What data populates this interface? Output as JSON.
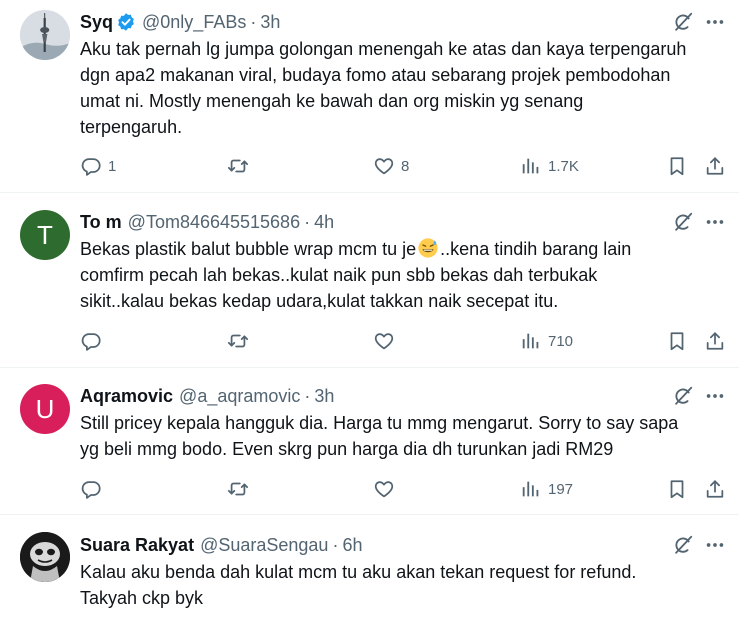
{
  "posts": [
    {
      "name": "Syq",
      "handle": "@0nly_FABs",
      "time": "3h",
      "verified": true,
      "lines": [
        "Aku tak pernah lg jumpa golongan menengah ke atas dan kaya terpengaruh",
        "dgn apa2 makanan viral, budaya fomo atau sebarang projek pembodohan",
        "umat ni. Mostly menengah ke bawah dan org miskin yg senang",
        "terpengaruh."
      ],
      "replies": "1",
      "reposts": "",
      "likes": "8",
      "views": "1.7K"
    },
    {
      "name": "To m",
      "handle": "@Tom846645515686",
      "time": "4h",
      "avatar_letter": "T",
      "avatar_color": "#2e6b2e",
      "lines_pre": "Bekas plastik balut bubble wrap mcm tu je",
      "lines_post": "..kena tindih barang lain",
      "lines": [
        "comfirm pecah lah bekas..kulat naik pun sbb bekas dah terbukak",
        "sikit..kalau bekas kedap udara,kulat takkan naik secepat itu."
      ],
      "replies": "",
      "reposts": "",
      "likes": "",
      "views": "710"
    },
    {
      "name": "Aqramovic",
      "handle": "@a_aqramovic",
      "time": "3h",
      "avatar_letter": "U",
      "avatar_color": "#d81e5b",
      "lines": [
        "Still pricey kepala hangguk dia. Harga tu mmg mengarut. Sorry to say sapa",
        "yg beli mmg bodo. Even skrg pun harga dia dh turunkan jadi RM29"
      ],
      "replies": "",
      "reposts": "",
      "likes": "",
      "views": "197"
    },
    {
      "name": "Suara Rakyat",
      "handle": "@SuaraSengau",
      "time": "6h",
      "lines": [
        "Kalau aku benda dah kulat mcm tu aku akan tekan request for refund.",
        "Takyah ckp byk"
      ]
    }
  ],
  "dot": "·",
  "colors": {
    "text": "#0f1419",
    "secondary": "#536471",
    "verified": "#1d9bf0",
    "divider": "#eff3f4"
  },
  "icons": [
    "verified-badge-icon",
    "grok-icon",
    "more-icon",
    "reply-icon",
    "repost-icon",
    "like-icon",
    "views-icon",
    "bookmark-icon",
    "share-icon",
    "grinning-sweat-emoji"
  ]
}
